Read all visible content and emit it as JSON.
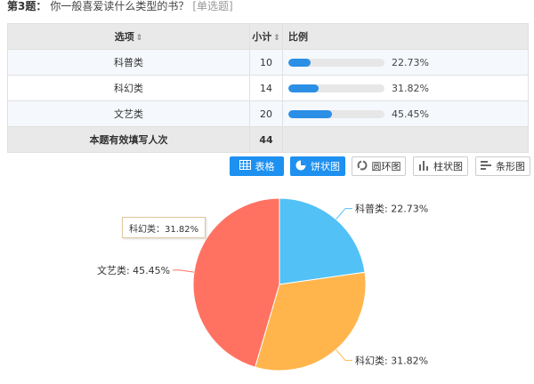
{
  "question": {
    "number": "第3题：",
    "text": "你一般喜爱读什么类型的书？",
    "type": "[单选题]"
  },
  "table": {
    "headers": {
      "option": "选项",
      "count": "小计",
      "ratio": "比例"
    },
    "sort_glyph": "⇕",
    "rows": [
      {
        "option": "科普类",
        "count": "10",
        "ratio": 0.2273,
        "percent": "22.73%"
      },
      {
        "option": "科幻类",
        "count": "14",
        "ratio": 0.3182,
        "percent": "31.82%"
      },
      {
        "option": "文艺类",
        "count": "20",
        "ratio": 0.4545,
        "percent": "45.45%"
      }
    ],
    "total": {
      "label": "本题有效填写人次",
      "count": "44"
    }
  },
  "toolbar": {
    "buttons": [
      {
        "label": "表格",
        "icon": "table-icon",
        "active": true
      },
      {
        "label": "饼状图",
        "icon": "pie-icon",
        "active": true
      },
      {
        "label": "圆环图",
        "icon": "ring-icon",
        "active": false
      },
      {
        "label": "柱状图",
        "icon": "column-icon",
        "active": false
      },
      {
        "label": "条形图",
        "icon": "bar-icon",
        "active": false
      }
    ]
  },
  "tooltip": {
    "text": "科幻类：31.82%"
  },
  "chart_data": {
    "type": "pie",
    "categories": [
      "科普类",
      "科幻类",
      "文艺类"
    ],
    "values": [
      22.73,
      31.82,
      45.45
    ],
    "labels": [
      "科普类: 22.73%",
      "科幻类: 31.82%",
      "文艺类: 45.45%"
    ],
    "colors": [
      "#52c1f5",
      "#ffb54c",
      "#ff7262"
    ],
    "start": "12 o'clock, clockwise"
  }
}
